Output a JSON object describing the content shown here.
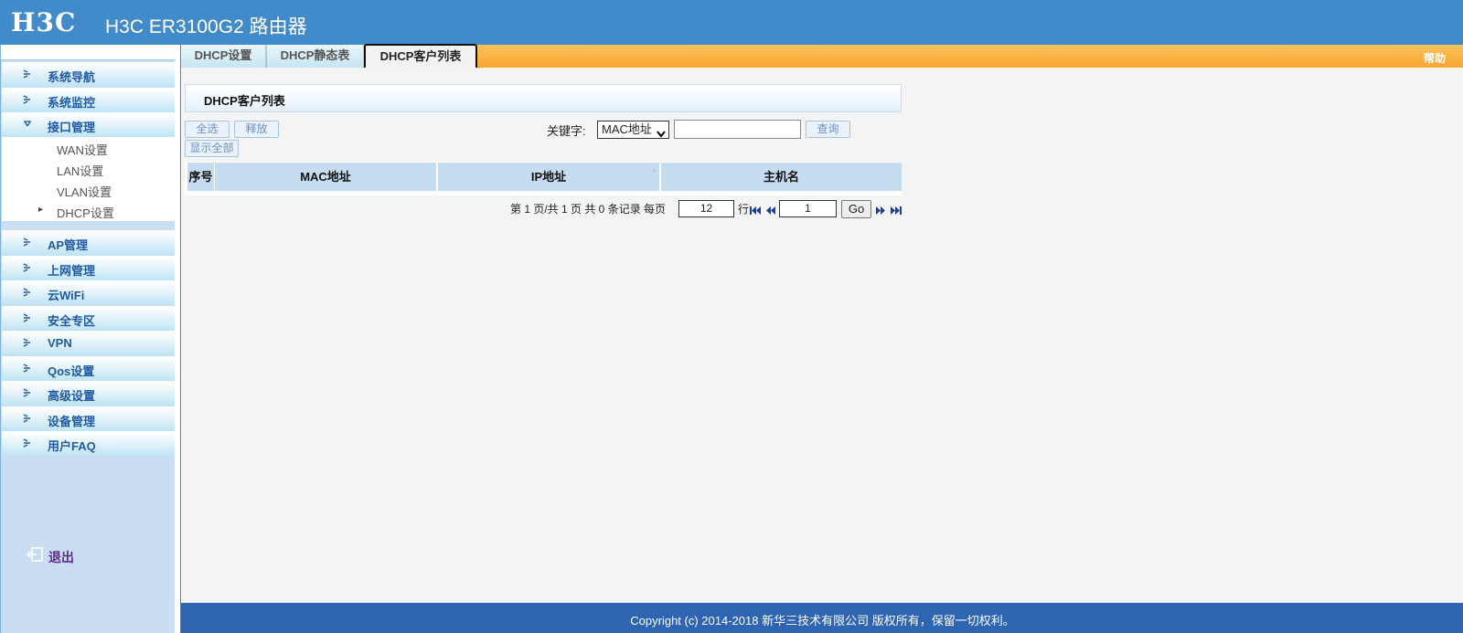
{
  "header": {
    "logo": "H3C",
    "title": "H3C ER3100G2 路由器"
  },
  "sidebar": {
    "items": [
      {
        "label": "系统导航"
      },
      {
        "label": "系统监控"
      },
      {
        "label": "接口管理"
      },
      {
        "label": "AP管理"
      },
      {
        "label": "上网管理"
      },
      {
        "label": "云WiFi"
      },
      {
        "label": "安全专区"
      },
      {
        "label": "VPN"
      },
      {
        "label": "Qos设置"
      },
      {
        "label": "高级设置"
      },
      {
        "label": "设备管理"
      },
      {
        "label": "用户FAQ"
      }
    ],
    "sub_items": [
      {
        "label": "WAN设置"
      },
      {
        "label": "LAN设置"
      },
      {
        "label": "VLAN设置"
      },
      {
        "label": "DHCP设置"
      }
    ],
    "logout": "退出"
  },
  "tabs": [
    {
      "label": "DHCP设置"
    },
    {
      "label": "DHCP静态表"
    },
    {
      "label": "DHCP客户列表"
    }
  ],
  "help": "帮助",
  "panel": {
    "title": "DHCP客户列表",
    "select_all": "全选",
    "release": "释放",
    "show_all": "显示全部",
    "keyword_label": "关键字:",
    "keyword_option": "MAC地址",
    "keyword_value": "",
    "query": "查询"
  },
  "table": {
    "columns": [
      "序号",
      "MAC地址",
      "IP地址",
      "主机名"
    ],
    "rows": []
  },
  "pager": {
    "text": "第 1 页/共 1 页 共 0 条记录 每页",
    "rows_per_page": "12",
    "row_unit": "行",
    "goto_page": "1",
    "go": "Go"
  },
  "footer": "Copyright (c) 2014-2018 新华三技术有限公司 版权所有，保留一切权利。"
}
